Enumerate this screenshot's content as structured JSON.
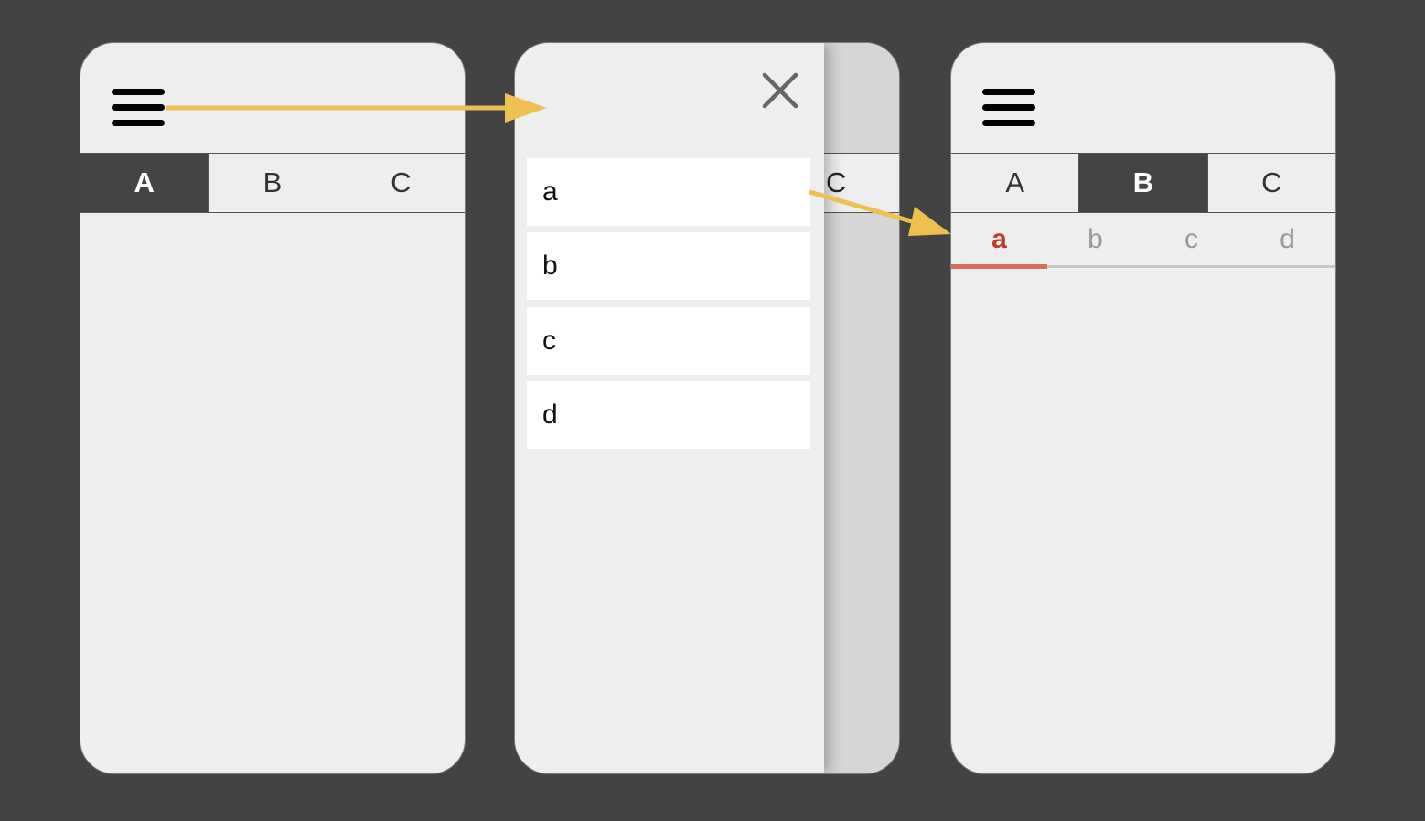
{
  "screen1": {
    "menu_icon": "hamburger-icon",
    "tabs": [
      {
        "label": "A",
        "active": true
      },
      {
        "label": "B",
        "active": false
      },
      {
        "label": "C",
        "active": false
      }
    ]
  },
  "screen2": {
    "close_icon": "close-icon",
    "behind_tab_label": "C",
    "menu_items": [
      "a",
      "b",
      "c",
      "d"
    ]
  },
  "screen3": {
    "menu_icon": "hamburger-icon",
    "tabs": [
      {
        "label": "A",
        "active": false
      },
      {
        "label": "B",
        "active": true
      },
      {
        "label": "C",
        "active": false
      }
    ],
    "subtabs": [
      {
        "label": "a",
        "active": true
      },
      {
        "label": "b",
        "active": false
      },
      {
        "label": "c",
        "active": false
      },
      {
        "label": "d",
        "active": false
      }
    ]
  },
  "colors": {
    "background": "#434343",
    "arrow": "#eec050",
    "active_tab": "#444444",
    "subtab_accent": "#c0392b"
  }
}
